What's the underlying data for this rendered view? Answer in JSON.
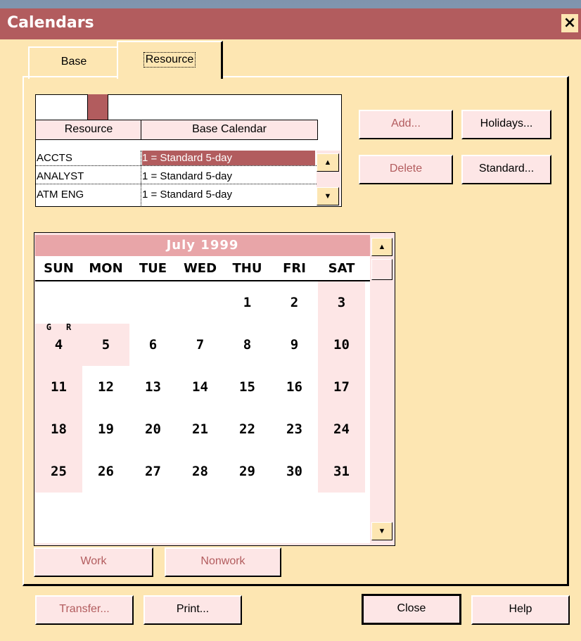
{
  "window": {
    "title": "Calendars",
    "close_symbol": "×"
  },
  "tabs": [
    {
      "label": "Base"
    },
    {
      "label": "Resource"
    }
  ],
  "resource_grid": {
    "columns": [
      "Resource",
      "Base Calendar"
    ],
    "rows": [
      {
        "resource": "ACCTS",
        "base_calendar": "1 = Standard 5-day"
      },
      {
        "resource": "ANALYST",
        "base_calendar": "1 = Standard 5-day"
      },
      {
        "resource": "ATM ENG",
        "base_calendar": "1 = Standard 5-day"
      }
    ],
    "selected_row": 0
  },
  "buttons": {
    "add": "Add...",
    "holidays": "Holidays...",
    "delete": "Delete",
    "standard": "Standard...",
    "work": "Work",
    "nonwork": "Nonwork",
    "transfer": "Transfer...",
    "print": "Print...",
    "close": "Close",
    "help": "Help"
  },
  "calendar": {
    "month_label": "July  1999",
    "weekdays": [
      "SUN",
      "MON",
      "TUE",
      "WED",
      "THU",
      "FRI",
      "SAT"
    ],
    "weeks": [
      [
        "",
        "",
        "",
        "",
        "1",
        "2",
        "3"
      ],
      [
        "4",
        "5",
        "6",
        "7",
        "8",
        "9",
        "10"
      ],
      [
        "11",
        "12",
        "13",
        "14",
        "15",
        "16",
        "17"
      ],
      [
        "18",
        "19",
        "20",
        "21",
        "22",
        "23",
        "24"
      ],
      [
        "25",
        "26",
        "27",
        "28",
        "29",
        "30",
        "31"
      ]
    ],
    "nonwork_days": [
      "3",
      "4",
      "5",
      "10",
      "11",
      "17",
      "18",
      "24",
      "25",
      "31"
    ],
    "day_markers": {
      "4": {
        "left": "G",
        "right": "R"
      }
    }
  },
  "colors": {
    "accent": "#b25c5e",
    "face": "#fde6b2",
    "light_pink": "#fde6e6",
    "month_header": "#e8a5a8"
  },
  "scroll_icons": {
    "up": "▲",
    "down": "▼"
  }
}
